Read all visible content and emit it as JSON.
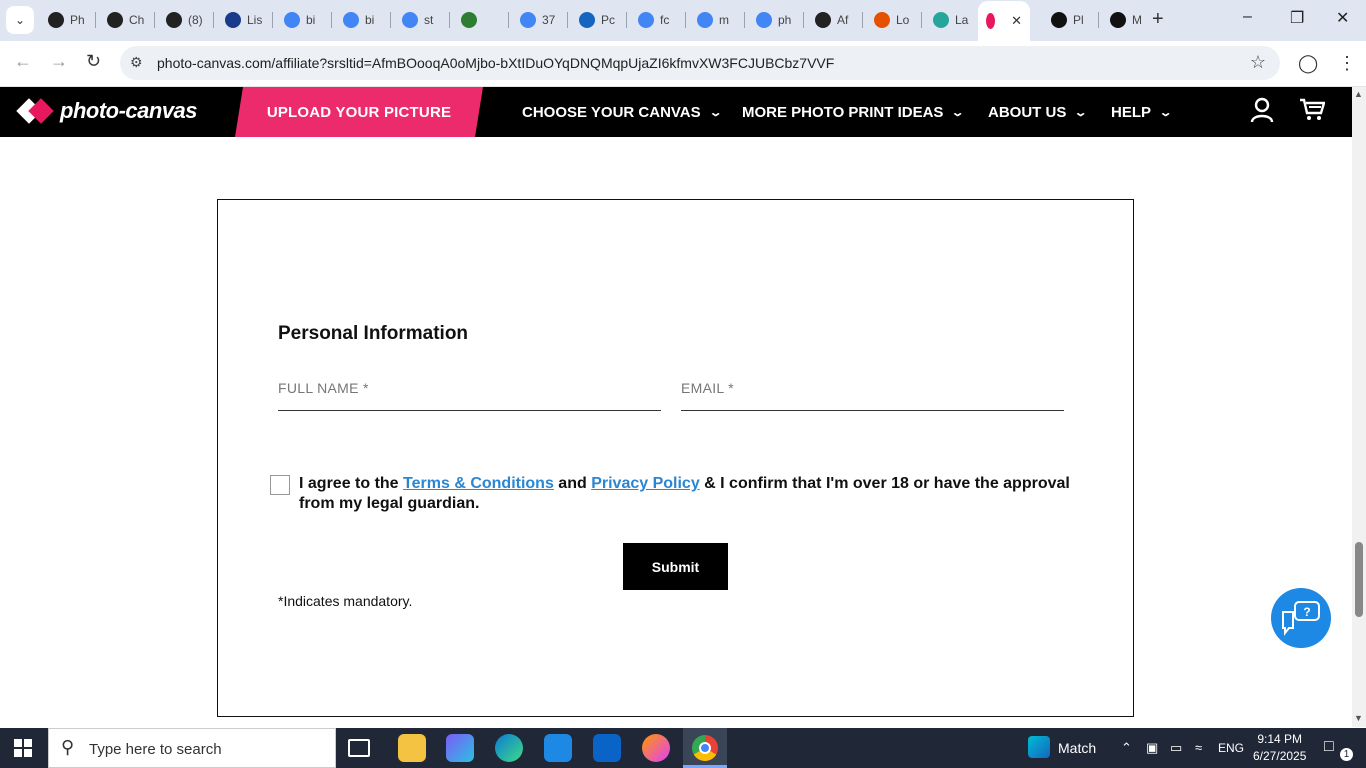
{
  "browser": {
    "tabs": [
      {
        "label": "Ph",
        "icon": "openai-icon",
        "color": "#222222"
      },
      {
        "label": "Ch",
        "icon": "openai-icon",
        "color": "#222222"
      },
      {
        "label": "(8)",
        "icon": "quora-icon",
        "color": "#222222"
      },
      {
        "label": "Lis",
        "icon": "ttp-icon",
        "color": "#1a3a8a"
      },
      {
        "label": "bi",
        "icon": "google-icon",
        "color": "#4285f4"
      },
      {
        "label": "bi",
        "icon": "google-icon",
        "color": "#4285f4"
      },
      {
        "label": "st",
        "icon": "google-icon",
        "color": "#4285f4"
      },
      {
        "label": "",
        "icon": "extension-icon",
        "color": "#2e7d32"
      },
      {
        "label": "37",
        "icon": "google-icon",
        "color": "#4285f4"
      },
      {
        "label": "Pc",
        "icon": "xf-icon",
        "color": "#1565c0"
      },
      {
        "label": "fc",
        "icon": "google-icon",
        "color": "#4285f4"
      },
      {
        "label": "m",
        "icon": "google-icon",
        "color": "#4285f4"
      },
      {
        "label": "ph",
        "icon": "google-icon",
        "color": "#4285f4"
      },
      {
        "label": "Af",
        "icon": "aperture-icon",
        "color": "#222222"
      },
      {
        "label": "Lo",
        "icon": "upwork-icon",
        "color": "#e65100"
      },
      {
        "label": "La",
        "icon": "globe-icon",
        "color": "#26a69a"
      },
      {
        "label": "",
        "icon": "photo-canvas-icon",
        "color": "#e8185f"
      },
      {
        "label": "Pl",
        "icon": "circle-icon",
        "color": "#111111"
      },
      {
        "label": "M",
        "icon": "camera-icon",
        "color": "#111111"
      }
    ],
    "url": "photo-canvas.com/affiliate?srsltid=AfmBOooqA0oMjbo-bXtIDuOYqDNQMqpUjaZI6kfmvXW3FCJUBCbz7VVF"
  },
  "header": {
    "logo_text": "photo-canvas",
    "upload_label": "UPLOAD YOUR PICTURE",
    "nav": [
      "CHOOSE YOUR CANVAS",
      "MORE PHOTO PRINT IDEAS",
      "ABOUT US",
      "HELP"
    ]
  },
  "form": {
    "section_title": "Personal Information",
    "full_name_placeholder": "FULL NAME *",
    "email_placeholder": "EMAIL *",
    "agree_prefix": "I agree to the ",
    "terms_link": "Terms & Conditions",
    "agree_and": " and ",
    "privacy_link": "Privacy Policy",
    "agree_suffix": " & I confirm that I'm over 18 or have the approval from my legal guardian.",
    "submit_label": "Submit",
    "mandatory_note": "*Indicates mandatory."
  },
  "taskbar": {
    "search_placeholder": "Type here to search",
    "widget_label": "Match",
    "language": "ENG",
    "time": "9:14 PM",
    "date": "6/27/2025",
    "notification_count": "1"
  },
  "colors": {
    "brand_pink": "#ec2b6d",
    "link_blue": "#2a86d3",
    "help_blue": "#1e88e5"
  }
}
